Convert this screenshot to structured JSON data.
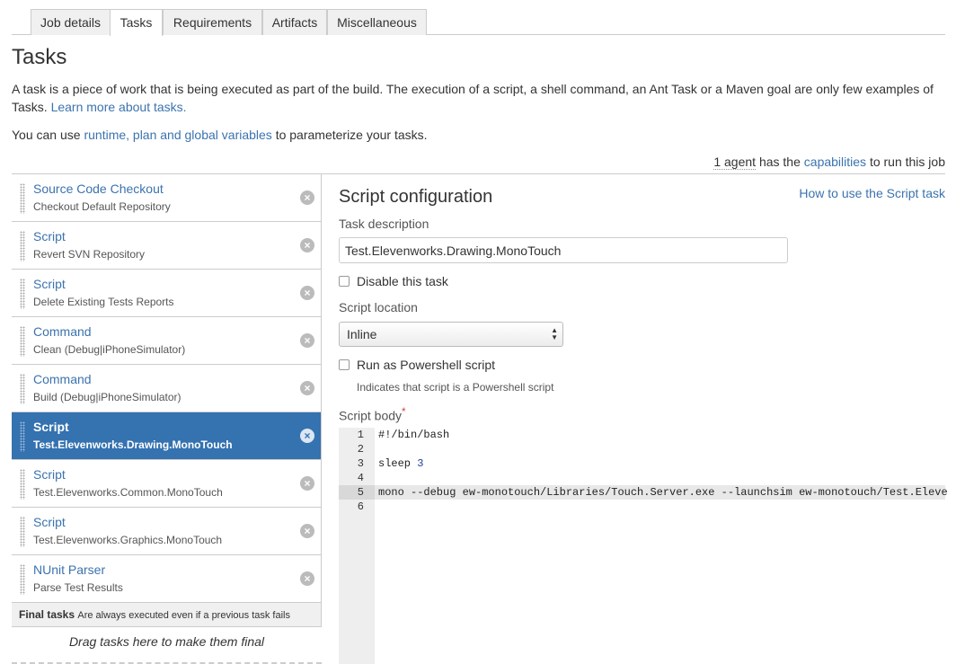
{
  "tabs": [
    {
      "label": "Job details"
    },
    {
      "label": "Tasks"
    },
    {
      "label": "Requirements"
    },
    {
      "label": "Artifacts"
    },
    {
      "label": "Miscellaneous"
    }
  ],
  "page_title": "Tasks",
  "intro": {
    "text": "A task is a piece of work that is being executed as part of the build. The execution of a script, a shell command, an Ant Task or a Maven goal are only few examples of Tasks.",
    "link": "Learn more about tasks."
  },
  "vars": {
    "prefix": "You can use",
    "link": "runtime, plan and global variables",
    "suffix": "to parameterize your tasks."
  },
  "agents": {
    "count": "1 agent",
    "middle": "has the",
    "link": "capabilities",
    "suffix": "to run this job"
  },
  "tasks": [
    {
      "name": "Source Code Checkout",
      "desc": "Checkout Default Repository"
    },
    {
      "name": "Script",
      "desc": "Revert SVN Repository"
    },
    {
      "name": "Script",
      "desc": "Delete Existing Tests Reports"
    },
    {
      "name": "Command",
      "desc": "Clean (Debug|iPhoneSimulator)"
    },
    {
      "name": "Command",
      "desc": "Build (Debug|iPhoneSimulator)"
    },
    {
      "name": "Script",
      "desc": "Test.Elevenworks.Drawing.MonoTouch"
    },
    {
      "name": "Script",
      "desc": "Test.Elevenworks.Common.MonoTouch"
    },
    {
      "name": "Script",
      "desc": "Test.Elevenworks.Graphics.MonoTouch"
    },
    {
      "name": "NUnit Parser",
      "desc": "Parse Test Results"
    }
  ],
  "final_tasks": {
    "title": "Final tasks",
    "note": "Are always executed even if a previous task fails",
    "drop_hint": "Drag tasks here to make them final"
  },
  "config": {
    "title": "Script configuration",
    "help_link": "How to use the Script task",
    "task_description_label": "Task description",
    "task_description_value": "Test.Elevenworks.Drawing.MonoTouch",
    "disable_label": "Disable this task",
    "script_location_label": "Script location",
    "script_location_value": "Inline",
    "powershell_label": "Run as Powershell script",
    "powershell_hint": "Indicates that script is a Powershell script",
    "script_body_label": "Script body",
    "required_mark": "*"
  },
  "code_lines": [
    {
      "num": "1",
      "text": "#!/bin/bash"
    },
    {
      "num": "2",
      "text": ""
    },
    {
      "num": "3",
      "text": "sleep",
      "arg": "3"
    },
    {
      "num": "4",
      "text": ""
    },
    {
      "num": "5",
      "text": "mono --debug ew-monotouch/Libraries/Touch.Server.exe --launchsim ew-monotouch/Test.Eleve"
    },
    {
      "num": "6",
      "text": ""
    }
  ],
  "colors": {
    "link": "#3b73af",
    "selected_task": "#3572b0",
    "required": "#d04437"
  }
}
